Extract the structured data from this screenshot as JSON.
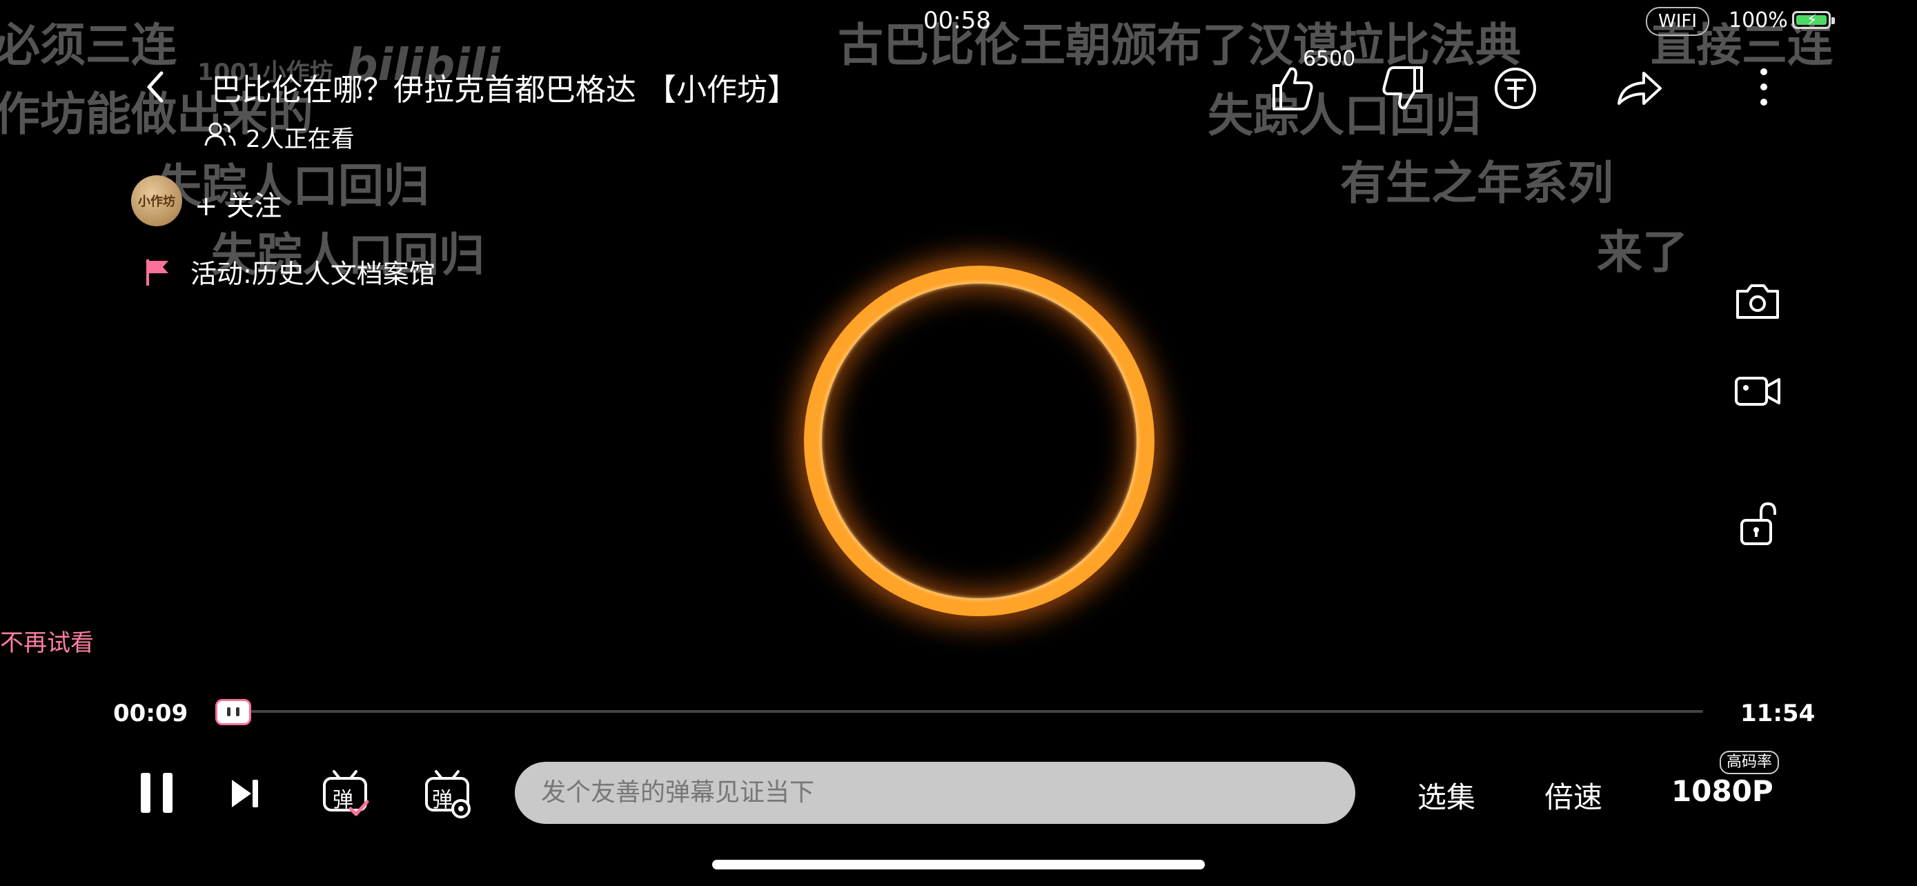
{
  "status_bar": {
    "time": "00:58",
    "network": "WIFI",
    "battery": "100%",
    "battery_level": 1.0
  },
  "video": {
    "title": "巴比伦在哪？伊拉克首都巴格达 【小作坊】",
    "viewers": "2人正在看",
    "uploader_avatar_text": "小作坊",
    "follow_label": "+ 关注",
    "activity": "活动:历史人文档案馆",
    "trial_notice": "不再试看"
  },
  "watermark": {
    "channel": "1001小作坊",
    "brand": "bilibili"
  },
  "danmaku": [
    "必须三连",
    "作坊能做出来的",
    "失踪人口回归",
    "失踪人口回归",
    "古巴比伦王朝颁布了汉谟拉比法典",
    "直接三连",
    "失踪人口回归",
    "有生之年系列",
    "来了"
  ],
  "actions": {
    "like_count": "6500"
  },
  "playback": {
    "current_time": "00:09",
    "total_time": "11:54",
    "progress": 0.0126,
    "danmaku_placeholder": "发个友善的弹幕见证当下",
    "episodes_label": "选集",
    "speed_label": "倍速",
    "quality_label": "1080P",
    "quality_badge": "高码率",
    "danmaku_toggle_glyph": "弹",
    "danmaku_settings_glyph": "弹"
  },
  "colors": {
    "accent": "#fb7299",
    "ring": "#ffa329",
    "background": "#000000"
  },
  "icons": [
    "back-icon",
    "viewers-icon",
    "flag-icon",
    "like-icon",
    "dislike-icon",
    "coin-icon",
    "share-icon",
    "more-icon",
    "camera-icon",
    "record-icon",
    "unlock-icon",
    "pause-icon",
    "next-icon",
    "danmaku-toggle-icon",
    "danmaku-settings-icon"
  ]
}
